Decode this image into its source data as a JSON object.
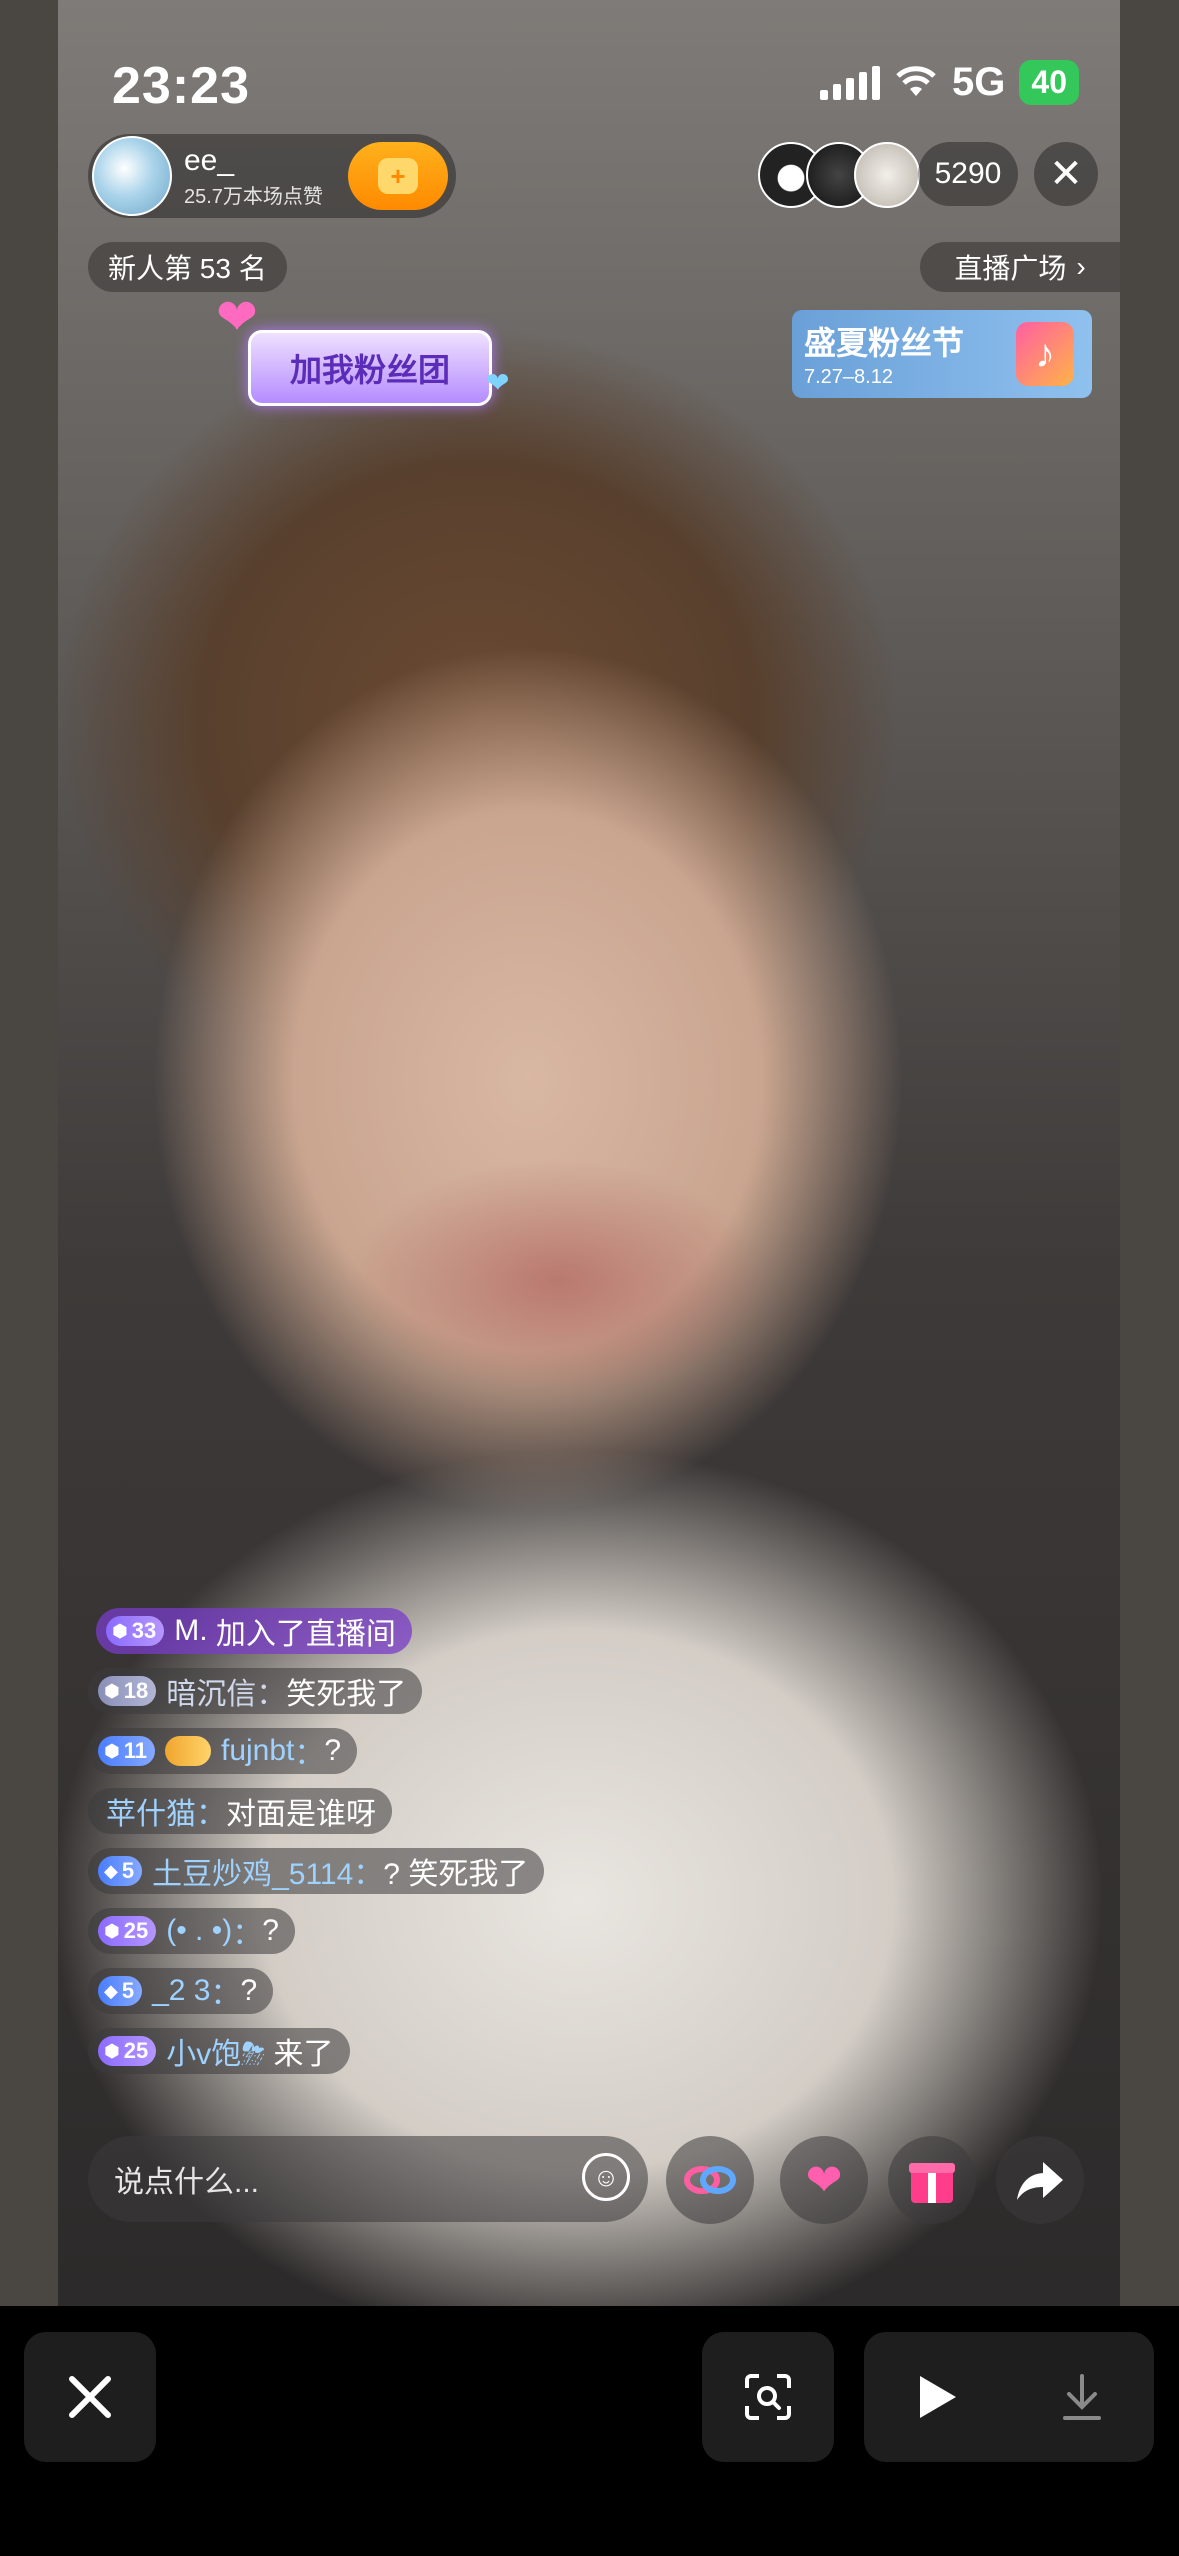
{
  "status_bar": {
    "time": "23:23",
    "network": "5G",
    "battery": "40"
  },
  "host": {
    "name": "ee_",
    "likes": "25.7万本场点赞",
    "avatar_icon": "avatar-icon",
    "follow_icon": "heart-plus-icon"
  },
  "viewers": {
    "count": "5290"
  },
  "rank": "新人第 53 名",
  "plaza": {
    "label": "直播广场",
    "icon": "chevron-right-icon"
  },
  "fanclub": {
    "label": "加我粉丝团"
  },
  "festival": {
    "title": "盛夏粉丝节",
    "dates": "7.27–8.12"
  },
  "chat": [
    {
      "level": "33",
      "name": "M.",
      "text": "加入了直播间",
      "type": "join"
    },
    {
      "level": "18",
      "name": "暗沉信",
      "text": "笑死我了"
    },
    {
      "level": "11",
      "name": "fujnbt",
      "text": "?"
    },
    {
      "level": "",
      "name": "苹什猫",
      "text": "对面是谁呀"
    },
    {
      "level": "5",
      "name": "土豆炒鸡_5114",
      "text": "? 笑死我了"
    },
    {
      "level": "25",
      "name": "(• . •)",
      "text": "?"
    },
    {
      "level": "5",
      "name": "_2 3",
      "text": "?"
    },
    {
      "level": "25",
      "name": "小v饱⛈",
      "text": "来了"
    }
  ],
  "input": {
    "placeholder": "说点什么..."
  },
  "actions": {
    "emoji": "smiley-icon",
    "link": "link-icon",
    "heart": "heart-icon",
    "gift": "gift-icon",
    "share": "share-arrow-icon"
  },
  "toolbar": {
    "close": "close-icon",
    "scan": "scan-icon",
    "play": "play-icon",
    "download": "download-icon"
  },
  "colors": {
    "battery": "#34c759",
    "follow": "#ff8a00",
    "fanclub": "#b48cff",
    "festival": "#6aa0d8"
  }
}
